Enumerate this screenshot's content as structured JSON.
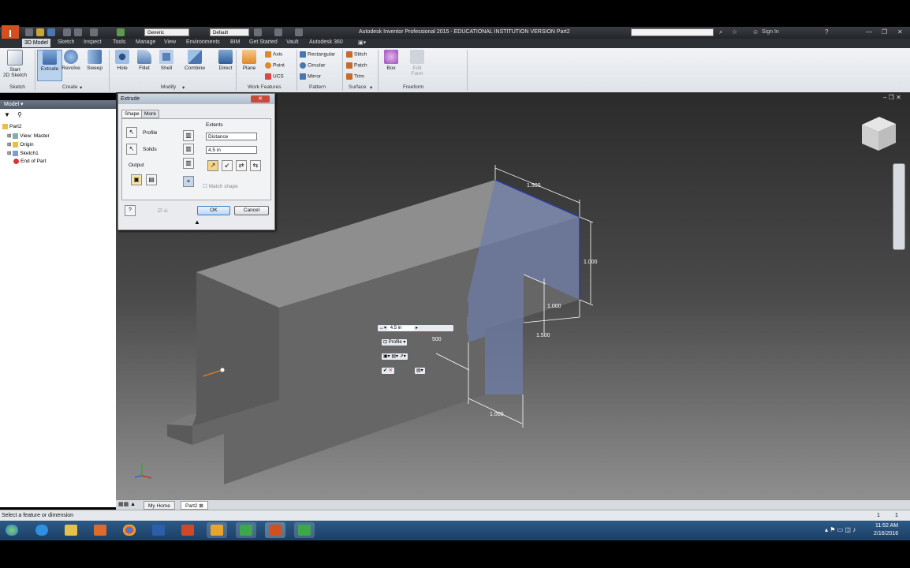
{
  "app": {
    "title": "Autodesk Inventor Professional 2015 - EDUCATIONAL INSTITUTION VERSION   Part2",
    "quick_access": {
      "appearance": "Generic",
      "material": "Default"
    },
    "sign_in": "Sign In"
  },
  "menu_tabs": [
    "3D Model",
    "Sketch",
    "Inspect",
    "Tools",
    "Manage",
    "View",
    "Environments",
    "BIM",
    "Get Started",
    "Vault",
    "Autodesk 360"
  ],
  "active_menu_tab": "3D Model",
  "ribbon": {
    "sketch": {
      "start_line1": "Start",
      "start_line2": "2D Sketch",
      "panel": "Sketch"
    },
    "create": {
      "extrude": "Extrude",
      "revolve": "Revolve",
      "sweep": "Sweep",
      "panel": "Create"
    },
    "modify": {
      "hole": "Hole",
      "fillet": "Fillet",
      "shell": "Shell",
      "combine": "Combine",
      "direct": "Direct",
      "panel": "Modify"
    },
    "work_features": {
      "plane": "Plane",
      "axis": "Axis",
      "point": "Point",
      "ucs": "UCS",
      "panel": "Work Features"
    },
    "pattern": {
      "rectangular": "Rectangular",
      "circular": "Circular",
      "mirror": "Mirror",
      "panel": "Pattern"
    },
    "surface": {
      "stitch": "Stitch",
      "patch": "Patch",
      "trim": "Trim",
      "panel": "Surface"
    },
    "freeform": {
      "box": "Box",
      "edit_line1": "Edit",
      "edit_line2": "Form",
      "panel": "Freeform"
    }
  },
  "browser": {
    "header": "Model",
    "items": [
      "Part2",
      "View: Master",
      "Origin",
      "Sketch1",
      "End of Part"
    ]
  },
  "dialog": {
    "title": "Extrude",
    "tabs": [
      "Shape",
      "More"
    ],
    "profile": "Profile",
    "solids": "Solids",
    "output": "Output",
    "extents": "Extents",
    "extents_type": "Distance",
    "distance": "4.5 in",
    "match_shape": "Match shape",
    "ok": "OK",
    "cancel": "Cancel"
  },
  "mini_toolbar": {
    "distance": "4.5 in",
    "profile": "Profile"
  },
  "dimensions": {
    "top": "1.500",
    "right": "1.000",
    "notch_w": "1.000",
    "notch_h": "1.500",
    "bottom": "1.000",
    "mini": "500"
  },
  "doc_tabs": [
    "My Home",
    "Part2"
  ],
  "status": {
    "left": "Select a feature or dimension",
    "right_a": "1",
    "right_b": "1"
  },
  "taskbar": {
    "time": "11:52 AM",
    "date": "2/16/2016"
  },
  "colors": {
    "ribbon_bg": "#e6e9ed",
    "selection_blue": "#4a5aa8",
    "taskbar": "#1f4a74"
  }
}
